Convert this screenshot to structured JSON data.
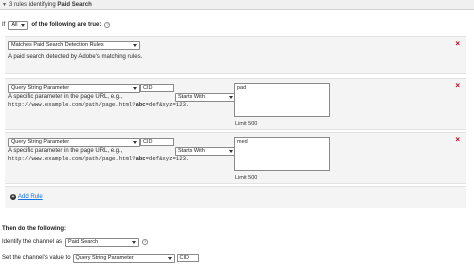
{
  "header": {
    "rule_count_prefix": "3 rules identifying",
    "channel_name": "Paid Search"
  },
  "if_row": {
    "if_label": "If",
    "mode_value": "All",
    "suffix": "of the following are true:"
  },
  "rules": [
    {
      "type_value": "Matches Paid Search Detection Rules",
      "description": "A paid search detected by Adobe's matching rules."
    },
    {
      "type_value": "Query String Parameter",
      "param_value": "CID",
      "operator_value": "Starts With",
      "match_value": "pad",
      "description_line1": "A specific parameter in the page URL, e.g.,",
      "description_url_prefix": "http://www.example.com/path/page.html?",
      "description_url_bold": "abc",
      "description_url_suffix": "=def&xyz=123.",
      "limit": "Limit 500"
    },
    {
      "type_value": "Query String Parameter",
      "param_value": "CID",
      "operator_value": "Starts With",
      "match_value": "med",
      "description_line1": "A specific parameter in the page URL, e.g.,",
      "description_url_prefix": "http://www.example.com/path/page.html?",
      "description_url_bold": "abc",
      "description_url_suffix": "=def&xyz=123.",
      "limit": "Limit 500"
    }
  ],
  "add_rule_label": "Add Rule",
  "then_label": "Then do the following:",
  "identify_row": {
    "label": "Identify the channel as",
    "channel_value": "Paid Search"
  },
  "set_value_row": {
    "label": "Set the channel's value to",
    "type_value": "Query String Parameter",
    "param_value": "CID"
  },
  "colors": {
    "remove": "#d0021b",
    "link": "#1473e6"
  },
  "icons": {
    "collapse": "chevron-down-icon",
    "help": "question-circle-icon",
    "remove": "close-icon",
    "add": "plus-circle-icon"
  }
}
